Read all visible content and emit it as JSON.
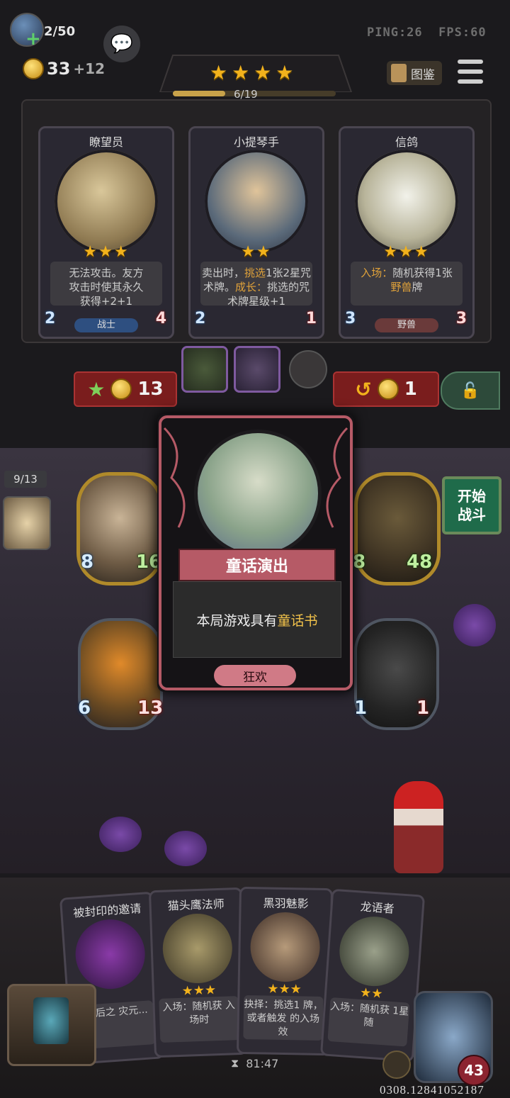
{
  "topbar": {
    "population": "2/50",
    "ping": "PING:26",
    "fps": "FPS:60",
    "gold": "33",
    "income": "+12",
    "stars": "★★★★",
    "progress_text": "6/19",
    "progress_fraction": 0.32,
    "guide_label": "图鉴"
  },
  "shop": {
    "cards": [
      {
        "name": "瞭望员",
        "stars": "★★★",
        "desc": [
          "无法攻击。友方",
          "攻击时使其永久",
          "获得+2+1"
        ],
        "atk": "2",
        "hp": "4",
        "tribe": "战士",
        "tribe_color": "#2e4f80"
      },
      {
        "name": "小提琴手",
        "stars": "★★",
        "desc_html_parts": [
          "卖出时，",
          "挑选",
          "1张2星咒",
          "术牌。",
          "成长：",
          "挑选的咒",
          "术牌星级+1"
        ],
        "atk": "2",
        "hp": "1",
        "tribe": "",
        "tribe_color": "transparent"
      },
      {
        "name": "信鸽",
        "stars": "★★★",
        "desc_html_parts": [
          "入场：",
          "随机获得1张",
          "野兽",
          "牌"
        ],
        "atk": "3",
        "hp": "3",
        "tribe": "野兽",
        "tribe_color": "#6a3a3a"
      }
    ],
    "upgrade_cost": "13",
    "refresh_cost": "1"
  },
  "board": {
    "hero_timer": "9/13",
    "start_battle": [
      "开始",
      "战斗"
    ],
    "minions": [
      {
        "atk": "8",
        "hp": "16"
      },
      {
        "atk": "8",
        "hp": "48"
      },
      {
        "atk": "6",
        "hp": "13"
      },
      {
        "atk": "1",
        "hp": "1"
      }
    ]
  },
  "popup": {
    "title": "童话演出",
    "body_prefix": "本局游戏具有",
    "body_highlight": "童话书",
    "tag": "狂欢"
  },
  "hand": {
    "cards": [
      {
        "name": "被封印的邀请",
        "desc": "6星后之 灾元..."
      },
      {
        "name": "猫头鹰法师",
        "stars": "★★★",
        "desc": "入场：随机获 入场时"
      },
      {
        "name": "黑羽魅影",
        "stars": "★★★",
        "desc": "抉择：挑选1 牌，或者触发 的入场效"
      },
      {
        "name": "龙语者",
        "stars": "★★",
        "desc": "入场：随机获 1星随"
      }
    ]
  },
  "footer": {
    "timer": "81:47",
    "hero_hp": "43",
    "game_id": "0308.12841052187"
  },
  "colors": {
    "gold": "#f2b21c",
    "accent_red": "#b65a66",
    "green": "#1f6b4a"
  }
}
